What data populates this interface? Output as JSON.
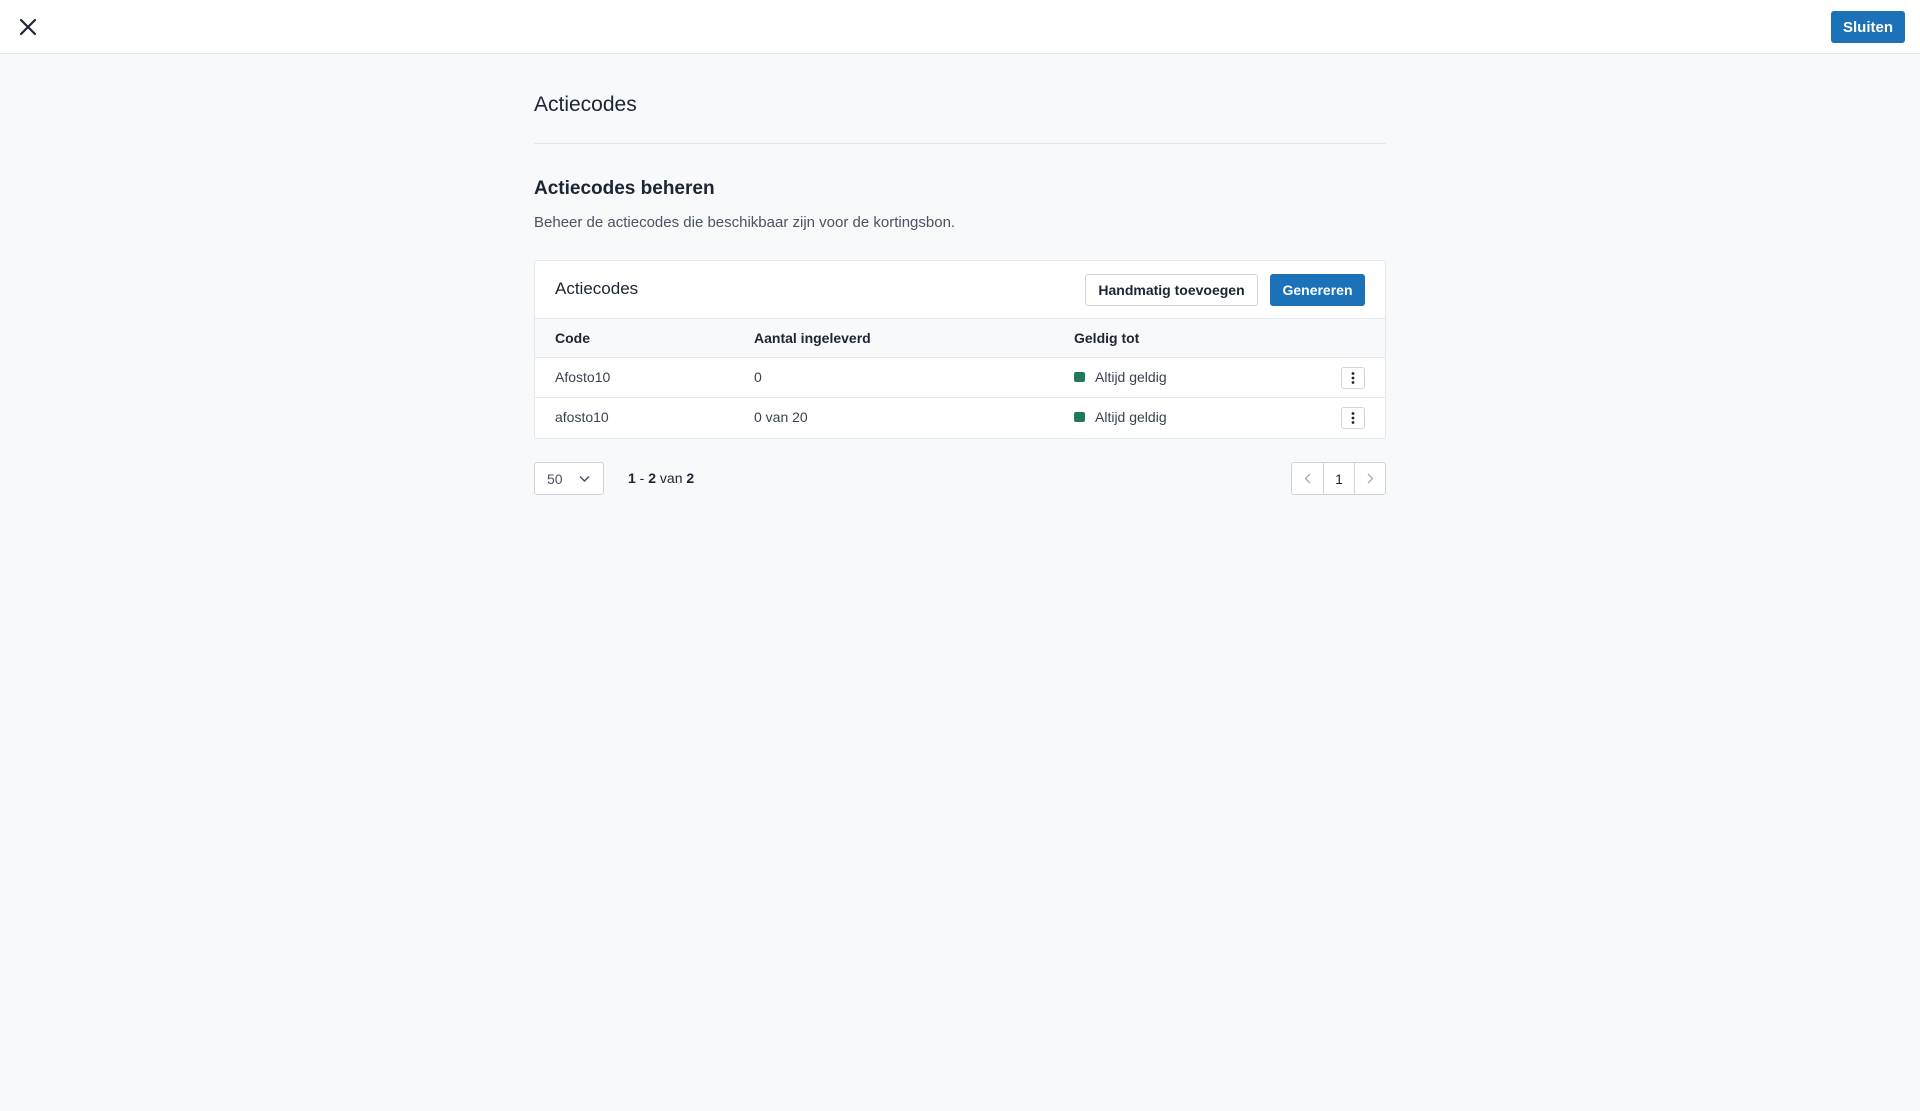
{
  "topbar": {
    "close_icon": "close-icon",
    "close_label": "Sluiten"
  },
  "page": {
    "title": "Actiecodes",
    "section_title": "Actiecodes beheren",
    "section_description": "Beheer de actiecodes die beschikbaar zijn voor de kortingsbon."
  },
  "card": {
    "title": "Actiecodes",
    "add_manual_label": "Handmatig toevoegen",
    "generate_label": "Genereren",
    "columns": [
      "Code",
      "Aantal ingeleverd",
      "Geldig tot"
    ],
    "rows": [
      {
        "code": "Afosto10",
        "redeemed": "0",
        "valid_until": "Altijd geldig",
        "status_color": "#1e7a5a"
      },
      {
        "code": "afosto10",
        "redeemed": "0 van 20",
        "valid_until": "Altijd geldig",
        "status_color": "#1e7a5a"
      }
    ]
  },
  "pagination": {
    "per_page": "50",
    "range_from": "1",
    "range_sep": " - ",
    "range_to": "2",
    "range_of": " van ",
    "total": "2",
    "current_page": "1"
  },
  "colors": {
    "primary": "#1b72b8",
    "status_valid": "#1e7a5a",
    "background": "#f8f9fb"
  }
}
